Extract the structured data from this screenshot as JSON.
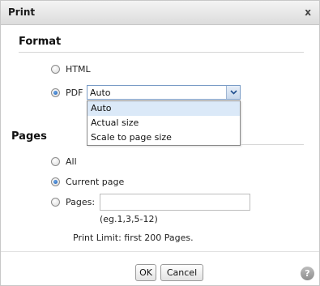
{
  "dialog": {
    "title": "Print"
  },
  "format": {
    "heading": "Format",
    "options": [
      {
        "label": "HTML",
        "checked": false
      },
      {
        "label": "PDF",
        "checked": true
      }
    ],
    "pdf_select": {
      "value": "Auto",
      "options": [
        "Auto",
        "Actual size",
        "Scale to page size"
      ],
      "highlighted": "Auto"
    }
  },
  "pages": {
    "heading": "Pages",
    "options": [
      {
        "label": "All",
        "checked": false
      },
      {
        "label": "Current page",
        "checked": true
      },
      {
        "label": "Pages:",
        "checked": false
      }
    ],
    "range_input": {
      "value": "",
      "placeholder": ""
    },
    "hint": "(eg.1,3,5-12)",
    "limit": "Print Limit: first 200 Pages."
  },
  "buttons": {
    "ok": "OK",
    "cancel": "Cancel",
    "help": "?"
  },
  "icons": {
    "close": "close-icon",
    "dropdown": "chevron-down-icon",
    "help": "help-icon"
  },
  "colors": {
    "select_border": "#7a9cc6",
    "highlight": "#dbe9f8",
    "radio_selected": "#1f5fb3"
  }
}
